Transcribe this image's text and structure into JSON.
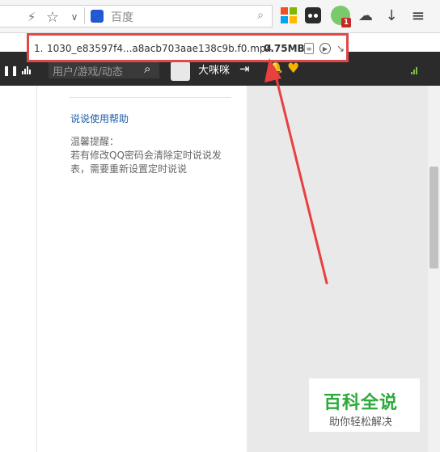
{
  "toolbar": {
    "search_placeholder": "百度",
    "icons": {
      "lightning": "bolt-icon",
      "star": "bookmark-star-icon",
      "chevron": "chevron-down-icon",
      "search_engine": "baidu-paw-icon",
      "search": "search-icon",
      "ext1": "color-grid-icon",
      "ext2": "mask-icon",
      "ext3": "avatar-icon",
      "cloud": "cloud-icon",
      "download": "download-arrow-icon",
      "menu": "hamburger-menu-icon"
    },
    "ext_badge": "1",
    "mosaic_colors": [
      "#f25022",
      "#7fba00",
      "#00a4ef",
      "#ffb900"
    ]
  },
  "download": {
    "index": "1.",
    "filename": "1030_e83597f4...a8acb703aae138c9b.f0.mp4",
    "size": "0.75MB",
    "border_color": "#e04848"
  },
  "site_bar": {
    "search_placeholder": "用户/游戏/动态",
    "username": "大咪咪",
    "bg_color": "#2b2b2b"
  },
  "content": {
    "help_link": "说说使用帮助",
    "tip_title": "温馨提醒：",
    "tip_body": "若有修改QQ密码会清除定时说说发表，需要重新设置定时说说"
  },
  "watermark": {
    "title": "百科全说",
    "subtitle": "助你轻松解决",
    "color": "#2eaa3c"
  },
  "annotation": {
    "arrow_color": "#e8403f"
  }
}
